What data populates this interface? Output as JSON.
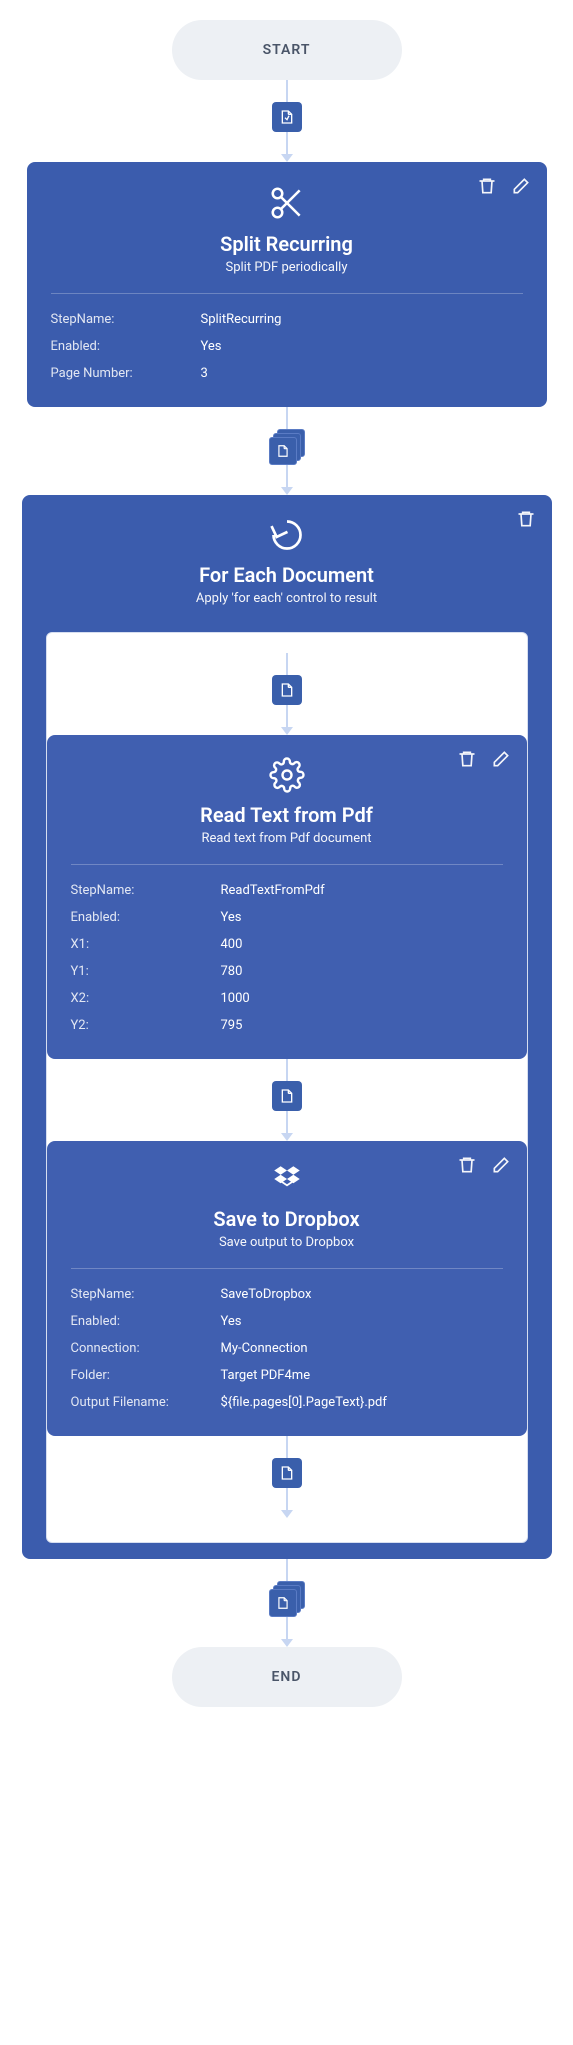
{
  "start": {
    "label": "START"
  },
  "end": {
    "label": "END"
  },
  "card_split": {
    "title": "Split Recurring",
    "subtitle": "Split PDF periodically",
    "props": [
      {
        "k": "StepName:",
        "v": "SplitRecurring"
      },
      {
        "k": "Enabled:",
        "v": "Yes"
      },
      {
        "k": "Page Number:",
        "v": "3"
      }
    ]
  },
  "card_foreach": {
    "title": "For Each Document",
    "subtitle": "Apply 'for each' control to result"
  },
  "card_read": {
    "title": "Read Text from Pdf",
    "subtitle": "Read text from Pdf document",
    "props": [
      {
        "k": "StepName:",
        "v": "ReadTextFromPdf"
      },
      {
        "k": "Enabled:",
        "v": "Yes"
      },
      {
        "k": "X1:",
        "v": "400"
      },
      {
        "k": "Y1:",
        "v": "780"
      },
      {
        "k": "X2:",
        "v": "1000"
      },
      {
        "k": "Y2:",
        "v": "795"
      }
    ]
  },
  "card_dropbox": {
    "title": "Save to Dropbox",
    "subtitle": "Save output to Dropbox",
    "props": [
      {
        "k": "StepName:",
        "v": "SaveToDropbox"
      },
      {
        "k": "Enabled:",
        "v": "Yes"
      },
      {
        "k": "Connection:",
        "v": "My-Connection"
      },
      {
        "k": "Folder:",
        "v": "Target PDF4me"
      },
      {
        "k": "Output Filename:",
        "v": "${file.pages[0].PageText}.pdf"
      }
    ]
  }
}
